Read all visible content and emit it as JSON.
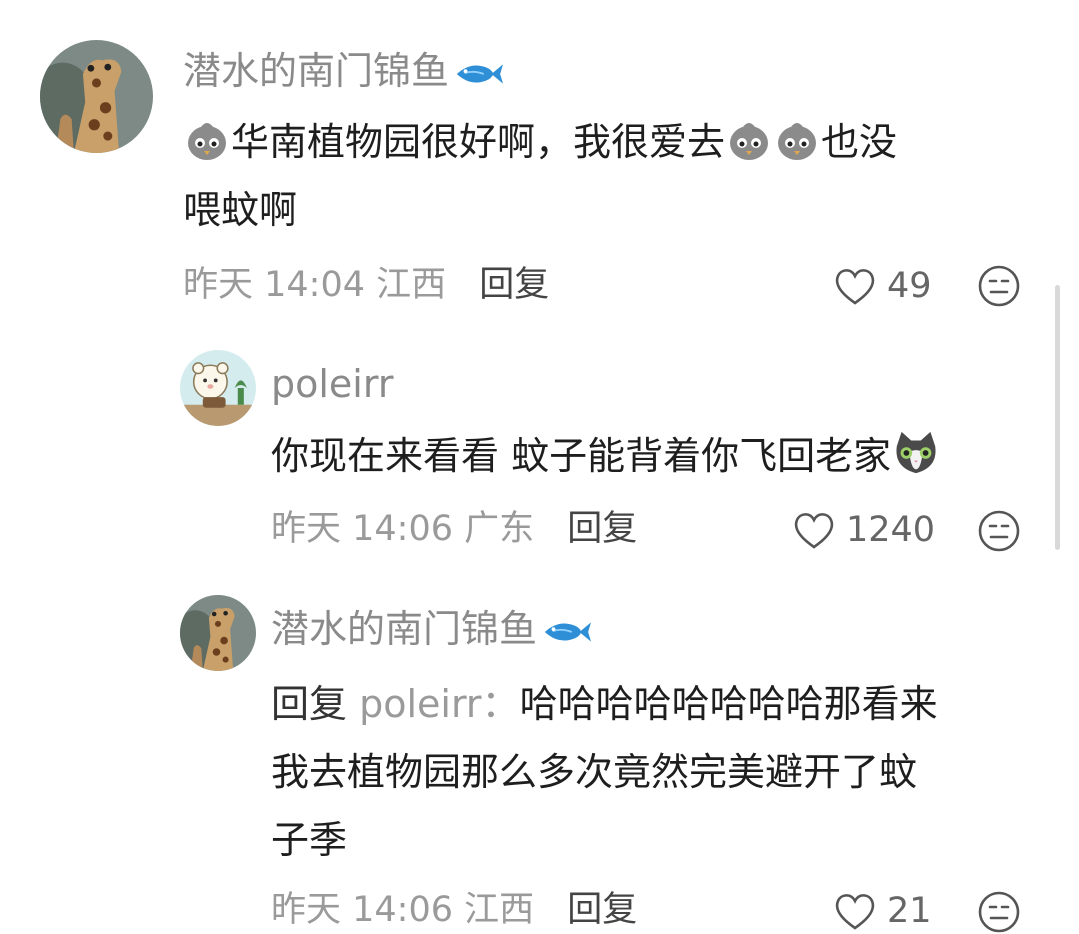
{
  "comments": [
    {
      "username": "潜水的南门锦鱼",
      "text_parts": [
        "华南植物园很好啊，我很爱去",
        "也没"
      ],
      "text_line2": "喂蚊啊",
      "time": "昨天 14:04",
      "location": "江西",
      "reply_label": "回复",
      "likes": "49"
    },
    {
      "username": "poleirr",
      "text": "你现在来看看 蚊子能背着你飞回老家",
      "time": "昨天 14:06",
      "location": "广东",
      "reply_label": "回复",
      "likes": "1240"
    },
    {
      "username": "潜水的南门锦鱼",
      "reply_prefix": "回复",
      "reply_target": "poleirr：",
      "text_line1": "哈哈哈哈哈哈哈哈那看来",
      "text_line2": "我去植物园那么多次竟然完美避开了蚊",
      "text_line3": "子季",
      "time": "昨天 14:06",
      "location": "江西",
      "reply_label": "回复",
      "likes": "21"
    }
  ],
  "colors": {
    "username": "#8a8a8a",
    "meta": "#9a9a9a",
    "text": "#1e1e1e"
  },
  "icons": [
    "giraffe-avatar",
    "bear-avatar",
    "fish-icon",
    "bird-emoji",
    "cat-emoji",
    "heart-icon",
    "dislike-face-icon"
  ]
}
